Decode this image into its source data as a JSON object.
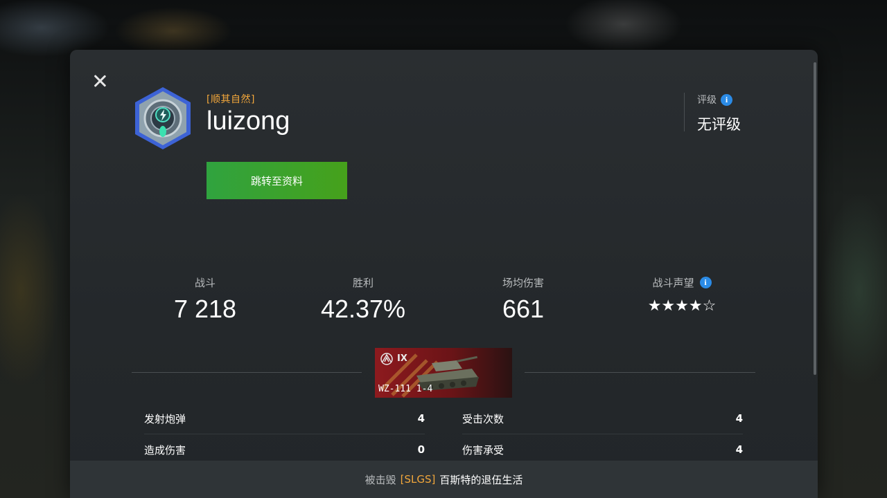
{
  "player": {
    "clan_tag": "[顺其自然]",
    "name": "luizong"
  },
  "actions": {
    "goto_profile": "跳转至资料"
  },
  "rating": {
    "label": "评级",
    "value": "无评级"
  },
  "stats": [
    {
      "label": "战斗",
      "value": "7 218"
    },
    {
      "label": "胜利",
      "value": "42.37%"
    },
    {
      "label": "场均伤害",
      "value": "661"
    },
    {
      "label": "战斗声望",
      "value": "★★★★☆",
      "stars_filled": 4,
      "stars_total": 5
    }
  ],
  "vehicle": {
    "tier": "IX",
    "name": "WZ-111 1-4"
  },
  "battle_stats": {
    "left": [
      {
        "label": "发射炮弹",
        "value": "4"
      },
      {
        "label": "造成伤害",
        "value": "0"
      }
    ],
    "right": [
      {
        "label": "受击次数",
        "value": "4"
      },
      {
        "label": "伤害承受",
        "value": "4"
      }
    ]
  },
  "footer": {
    "prefix": "被击毁",
    "clan": "[SLGS]",
    "killer": "百斯特的退伍生活"
  },
  "colors": {
    "accent": "#f2a73b",
    "button_green": "#3aa22e",
    "info_blue": "#2b8be6"
  }
}
